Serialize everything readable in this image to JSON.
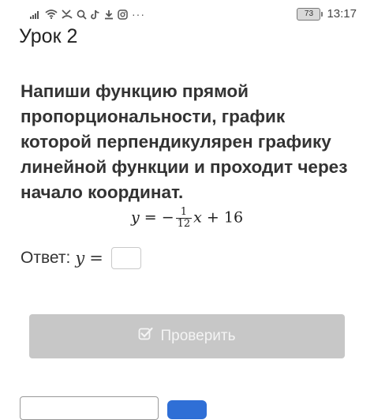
{
  "status_bar": {
    "icons": [
      "signal-icon",
      "wifi-icon",
      "missed-call-icon",
      "search-icon",
      "tiktok-icon",
      "download-icon",
      "instagram-icon",
      "more-dots-icon"
    ],
    "more_dots": "···",
    "battery_level": "73",
    "time": "13:17"
  },
  "lesson": {
    "title": "Урок 2"
  },
  "task": {
    "text": "Напиши функцию прямой пропорциональности, график которой перпендикулярен графику линейной функции и проходит через начало координат."
  },
  "formula": {
    "lhs": "y",
    "equals": "=",
    "minus": "−",
    "numerator": "1",
    "denominator": "12",
    "variable": "x",
    "plus_term": "+ 16"
  },
  "answer": {
    "label": "Ответ:",
    "var": "y",
    "equals": "=",
    "value": "",
    "placeholder": ""
  },
  "check_button": {
    "label": "Проверить",
    "icon": "checkbox-check-icon"
  },
  "colors": {
    "button_disabled_bg": "#c7c7c7",
    "button_text": "#f4f4f4",
    "accent_blue": "#2f6fd6",
    "text": "#333333"
  }
}
